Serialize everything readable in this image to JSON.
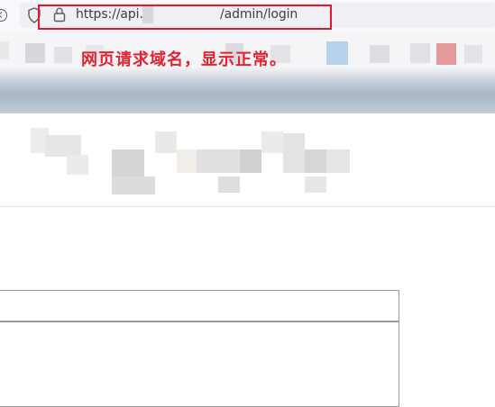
{
  "browser": {
    "url_prefix": "https://api.",
    "url_suffix": "/admin/login",
    "icons": [
      "back-icon",
      "shield-icon",
      "lock-icon"
    ]
  },
  "annotation": {
    "text": "网页请求域名，显示正常。",
    "color": "#e8212f"
  },
  "colors": {
    "highlight": "#e0182d",
    "banner": "#a8b6c6"
  }
}
